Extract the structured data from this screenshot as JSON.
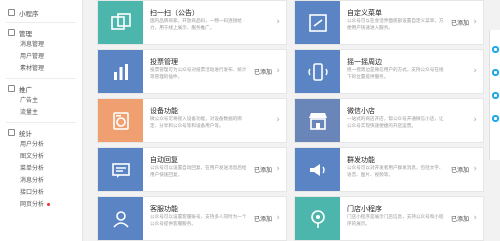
{
  "sidebar": {
    "section_miniprogram": "小程序",
    "section_manage": "管理",
    "manage_items": [
      "消息管理",
      "用户管理",
      "素材管理"
    ],
    "section_promote": "推广",
    "promote_items": [
      "广告主",
      "流量主"
    ],
    "section_stats": "统计",
    "stats_items": [
      "用户分析",
      "图文分析",
      "菜单分析",
      "消息分析",
      "接口分析",
      "网页分析"
    ]
  },
  "cards": [
    {
      "title": "扫一扫（公告）",
      "desc": "国内品牌商家，开放商品码，一物一码连接给力，用于线上展示、服务推广。",
      "status": "",
      "color": "#4db6ac",
      "icon": "scan-icon"
    },
    {
      "title": "自定义菜单",
      "desc": "公众号可以在会话界面底部设置自定义菜单，方便用户快速进入服务。",
      "status": "已添加",
      "color": "#5b84c4",
      "icon": "menu-icon"
    },
    {
      "title": "投票管理",
      "desc": "投票管理可为公众号对投票活动进行发布、统计等管理的插件。",
      "status": "已添加",
      "color": "#5b84c4",
      "icon": "vote-icon"
    },
    {
      "title": "摇一摇周边",
      "desc": "摇一摇周边是微信用户的方式，支持公众号在线下的位置提供服务。",
      "status": "",
      "color": "#5b84c4",
      "icon": "shake-icon"
    },
    {
      "title": "设备功能",
      "desc": "微公众号可将接入设备功能，对设备数据的绑定、分享和公众号等和设备用户等。",
      "status": "",
      "color": "#f0a070",
      "icon": "device-icon"
    },
    {
      "title": "微信小店",
      "desc": "一站式的商店开店，帮公众号开通微信小店，让公众号实现快速便捷的开店运营。",
      "status": "",
      "color": "#6a86b8",
      "icon": "shop-icon"
    },
    {
      "title": "自动回复",
      "desc": "公众号可以设置自动回复，在用户发送消息后给用户快速回复。",
      "status": "已添加",
      "color": "#5b84c4",
      "icon": "reply-icon"
    },
    {
      "title": "群发功能",
      "desc": "公众号可以对开发者用户群发消息，包括文字、语音、图片、视频等。",
      "status": "已添加",
      "color": "#5b84c4",
      "icon": "mass-icon"
    },
    {
      "title": "客服功能",
      "desc": "公众号可以设置客服账号，支持多人同时为一个公众号提供客服服务。",
      "status": "已添加",
      "color": "#5b84c4",
      "icon": "service-icon"
    },
    {
      "title": "门店小程序",
      "desc": "门店小程序是展示门店信息，支持公众号和小程序的展示。",
      "status": "已添加",
      "color": "#4db6ac",
      "icon": "store-icon"
    }
  ]
}
